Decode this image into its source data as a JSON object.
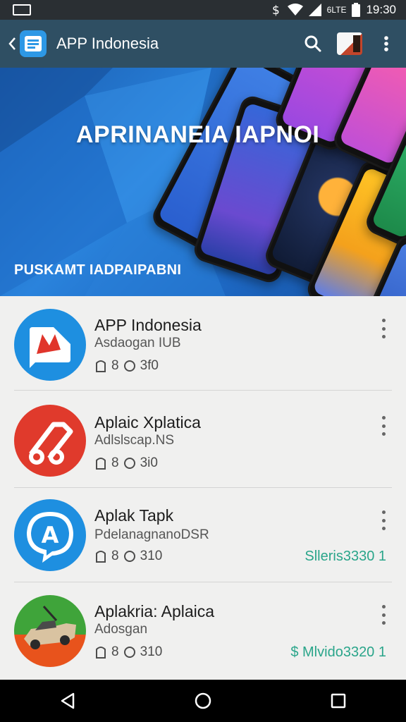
{
  "status_bar": {
    "signal_text": "6LTE",
    "time": "19:30",
    "icons": [
      "screen-cast-icon",
      "data-saver-icon",
      "wifi-icon",
      "signal-icon",
      "battery-icon"
    ]
  },
  "app_bar": {
    "title": "APP Indonesia",
    "icons": [
      "back-icon",
      "app-logo-icon",
      "search-icon",
      "avatar",
      "overflow-menu-icon"
    ]
  },
  "banner": {
    "title": "APRINANEIA IAPNOI",
    "subtitle": "PUSKAMT IADPAIPABNI"
  },
  "apps": [
    {
      "title": "APP Indonesia",
      "subtitle": "Asdaogan IUB",
      "meta_count_a": "8",
      "meta_count_b": "3f0",
      "price": "",
      "icon": "app-indonesia-logo",
      "color": "#1e8fe0"
    },
    {
      "title": "Aplaic Xplatica",
      "subtitle": "Adlslscap.NS",
      "meta_count_a": "8",
      "meta_count_b": "3i0",
      "price": "",
      "icon": "scissors-logo",
      "color": "#e03a2c"
    },
    {
      "title": "Aplak Tapk",
      "subtitle": "PdelanagnanoDSR",
      "meta_count_a": "8",
      "meta_count_b": "310",
      "price": "Slleris3330 1",
      "icon": "chat-bubble-logo",
      "color": "#1e8fe0"
    },
    {
      "title": "Aplakria: Aplaica",
      "subtitle": "Adosgan",
      "meta_count_a": "8",
      "meta_count_b": "310",
      "price": "$ Mlvido3320 1",
      "icon": "vehicle-logo",
      "color": "#3fa43a"
    }
  ],
  "accent_color": "#2aa58a",
  "nav_bar": {
    "icons": [
      "nav-back-icon",
      "nav-home-icon",
      "nav-recents-icon"
    ]
  }
}
